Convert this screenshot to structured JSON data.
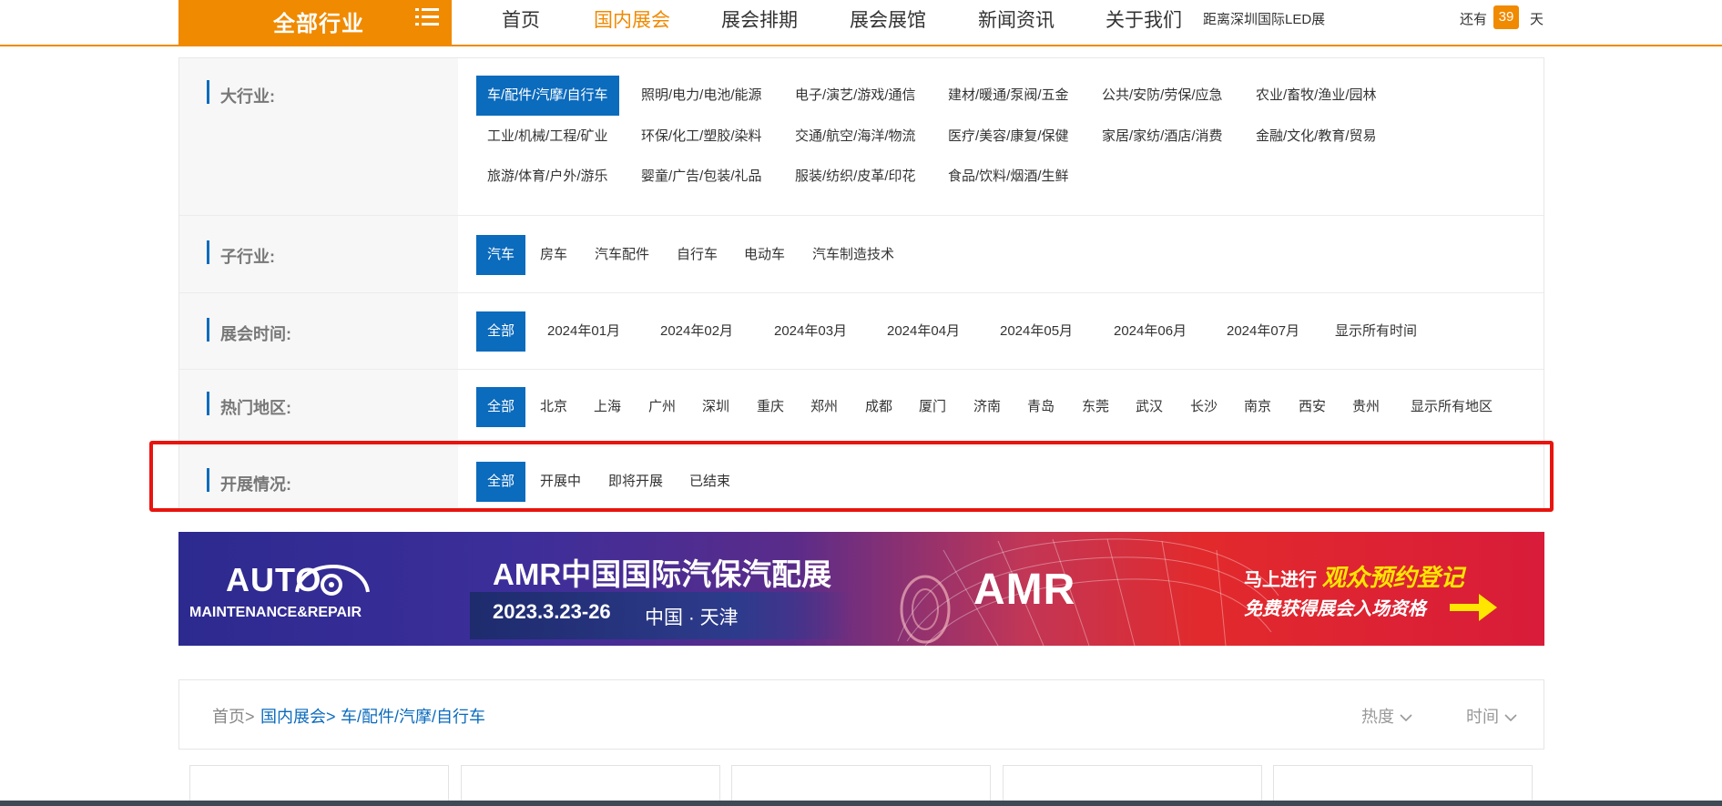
{
  "header": {
    "all_categories_label": "全部行业",
    "nav": [
      "首页",
      "国内展会",
      "展会排期",
      "展会展馆",
      "新闻资讯",
      "关于我们"
    ],
    "active_nav": "国内展会",
    "countdown_prefix": "距离深圳国际LED展",
    "countdown_still": "还有",
    "countdown_days": "39",
    "countdown_unit": "天"
  },
  "filters": {
    "industry": {
      "label": "大行业:",
      "options": [
        "车/配件/汽摩/自行车",
        "照明/电力/电池/能源",
        "电子/演艺/游戏/通信",
        "建材/暖通/泵阀/五金",
        "公共/安防/劳保/应急",
        "农业/畜牧/渔业/园林",
        "工业/机械/工程/矿业",
        "环保/化工/塑胶/染料",
        "交通/航空/海洋/物流",
        "医疗/美容/康复/保健",
        "家居/家纺/酒店/消费",
        "金融/文化/教育/贸易",
        "旅游/体育/户外/游乐",
        "婴童/广告/包装/礼品",
        "服装/纺织/皮革/印花",
        "食品/饮料/烟酒/生鲜"
      ],
      "selected": "车/配件/汽摩/自行车"
    },
    "sub_industry": {
      "label": "子行业:",
      "options": [
        "汽车",
        "房车",
        "汽车配件",
        "自行车",
        "电动车",
        "汽车制造技术"
      ],
      "selected": "汽车"
    },
    "time": {
      "label": "展会时间:",
      "options": [
        "全部",
        "2024年01月",
        "2024年02月",
        "2024年03月",
        "2024年04月",
        "2024年05月",
        "2024年06月",
        "2024年07月",
        "显示所有时间"
      ],
      "selected": "全部"
    },
    "region": {
      "label": "热门地区:",
      "options": [
        "全部",
        "北京",
        "上海",
        "广州",
        "深圳",
        "重庆",
        "郑州",
        "成都",
        "厦门",
        "济南",
        "青岛",
        "东莞",
        "武汉",
        "长沙",
        "南京",
        "西安",
        "贵州",
        "显示所有地区"
      ],
      "selected": "全部"
    },
    "status": {
      "label": "开展情况:",
      "options": [
        "全部",
        "开展中",
        "即将开展",
        "已结束"
      ],
      "selected": "全部"
    }
  },
  "banner": {
    "logo_text": "AUTO",
    "logo_sub": "MAINTENANCE&REPAIR",
    "title": "AMR中国国际汽保汽配展",
    "date": "2023.3.23-26",
    "place": "中国 · 天津",
    "brand": "AMR",
    "cta_prefix": "马上进行",
    "cta_highlight": "观众预约登记",
    "cta_line2": "免费获得展会入场资格"
  },
  "breadcrumb": {
    "home": "首页>",
    "domestic": "国内展会>",
    "current": "车/配件/汽摩/自行车"
  },
  "sort": {
    "heat": "热度",
    "time": "时间"
  },
  "colors": {
    "brand_orange": "#f08a00",
    "selected_blue": "#0b6bbd",
    "highlight_red": "#e8140e"
  }
}
